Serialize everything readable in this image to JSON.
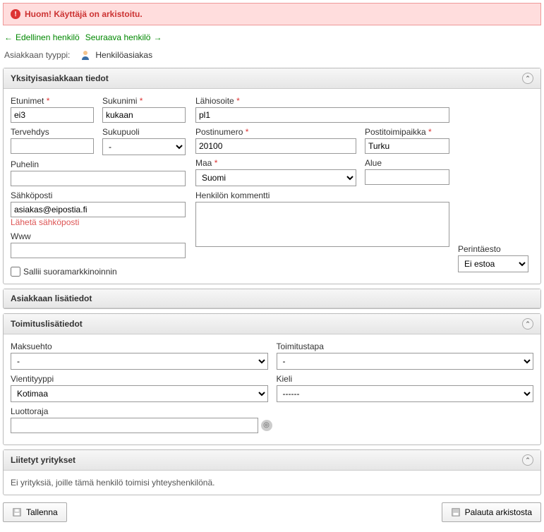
{
  "alert": {
    "text": "Huom! Käyttäjä on arkistoitu."
  },
  "nav": {
    "prev": "Edellinen henkilö",
    "next": "Seuraava henkilö"
  },
  "type": {
    "label": "Asiakkaan tyyppi:",
    "value": "Henkilöasiakas"
  },
  "panel1": {
    "title": "Yksityisasiakkaan tiedot",
    "firstname_lbl": "Etunimet",
    "firstname": "ei3",
    "lastname_lbl": "Sukunimi",
    "lastname": "kukaan",
    "greeting_lbl": "Tervehdys",
    "greeting": "",
    "gender_lbl": "Sukupuoli",
    "gender": "-",
    "phone_lbl": "Puhelin",
    "phone": "",
    "email_lbl": "Sähköposti",
    "email": "asiakas@eipostia.fi",
    "sendmail": "Lähetä sähköposti",
    "www_lbl": "Www",
    "www": "",
    "marketing": "Sallii suoramarkkinoinnin",
    "address_lbl": "Lähiosoite",
    "address": "pl1",
    "postal_lbl": "Postinumero",
    "postal": "20100",
    "city_lbl": "Postitoimipaikka",
    "city": "Turku",
    "country_lbl": "Maa",
    "country": "Suomi",
    "region_lbl": "Alue",
    "region": "",
    "comment_lbl": "Henkilön kommentti",
    "comment": "",
    "collection_lbl": "Perintäesto",
    "collection": "Ei estoa"
  },
  "panel2": {
    "title": "Asiakkaan lisätiedot"
  },
  "panel3": {
    "title": "Toimituslisätiedot",
    "payterm_lbl": "Maksuehto",
    "payterm": "-",
    "delivery_lbl": "Toimitustapa",
    "delivery": "-",
    "export_lbl": "Vientityyppi",
    "export": "Kotimaa",
    "lang_lbl": "Kieli",
    "lang": "------",
    "credit_lbl": "Luottoraja",
    "credit": ""
  },
  "panel4": {
    "title": "Liitetyt yritykset",
    "empty": "Ei yrityksiä, joille tämä henkilö toimisi yhteyshenkilönä."
  },
  "btns": {
    "save": "Tallenna",
    "restore": "Palauta arkistosta"
  }
}
